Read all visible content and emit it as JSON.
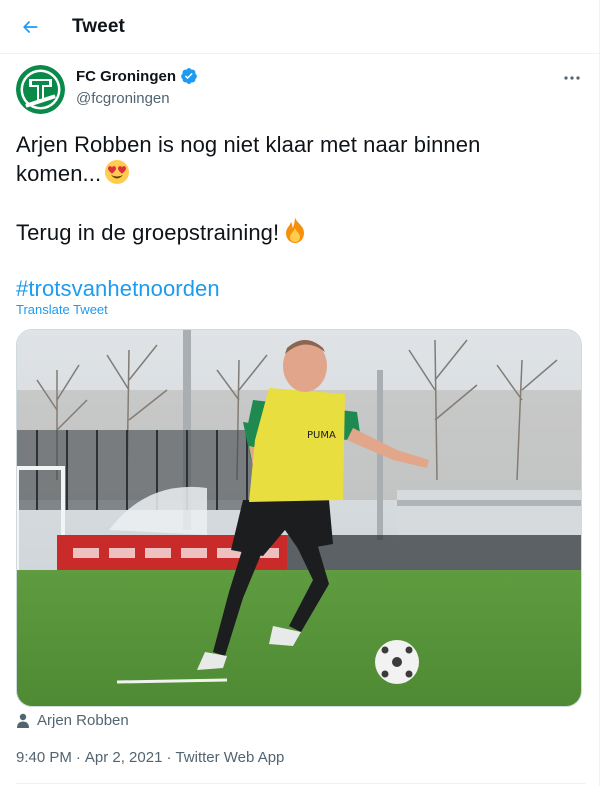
{
  "header": {
    "title": "Tweet",
    "back_icon": "arrow-left-icon"
  },
  "author": {
    "name": "FC Groningen",
    "handle": "@fcgroningen",
    "verified": true,
    "avatar_text": "FC GRONINGEN",
    "brand_color": "#0a8a49"
  },
  "tweet": {
    "line1": "Arjen Robben is nog niet klaar met naar binnen",
    "line2": "komen...",
    "line3": "Terug in de groepstraining!",
    "hashtag": "#trotsvanhetnoorden",
    "emoji_1": "heart-eyes-emoji",
    "emoji_2": "fire-emoji"
  },
  "translate_label": "Translate Tweet",
  "tagged_user": "Arjen Robben",
  "meta": {
    "time": "9:40 PM",
    "date": "Apr 2, 2021",
    "source": "Twitter Web App",
    "separator": "·"
  },
  "colors": {
    "accent": "#1d9bf0",
    "muted": "#536471",
    "text": "#0f1419"
  }
}
